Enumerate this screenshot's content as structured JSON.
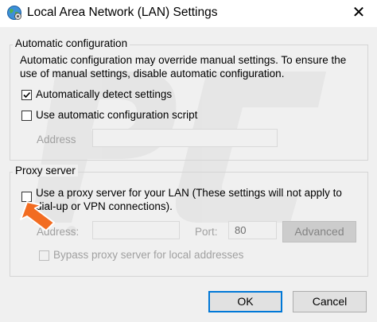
{
  "window": {
    "title": "Local Area Network (LAN) Settings",
    "icon": "globe-settings-icon",
    "close_glyph": "✕"
  },
  "auto_config": {
    "group_label": "Automatic configuration",
    "description_line1": "Automatic configuration may override manual settings.  To ensure the",
    "description_line2": "use of manual settings, disable automatic configuration.",
    "detect_label": "Automatically detect settings",
    "detect_checked": true,
    "script_label": "Use automatic configuration script",
    "script_checked": false,
    "address_label": "Address",
    "address_value": ""
  },
  "proxy": {
    "group_label": "Proxy server",
    "use_proxy_line1": "Use a proxy server for your LAN (These settings will not apply to",
    "use_proxy_line2": "dial-up or VPN connections).",
    "use_proxy_checked": false,
    "address_label": "Address:",
    "address_value": "",
    "port_label": "Port:",
    "port_value": "80",
    "advanced_label": "Advanced",
    "bypass_label": "Bypass proxy server for local addresses",
    "bypass_checked": false
  },
  "buttons": {
    "ok_label": "OK",
    "cancel_label": "Cancel"
  },
  "colors": {
    "accent": "#0078d7",
    "arrow": "#f26c21",
    "window_bg": "#f0f0f0"
  }
}
